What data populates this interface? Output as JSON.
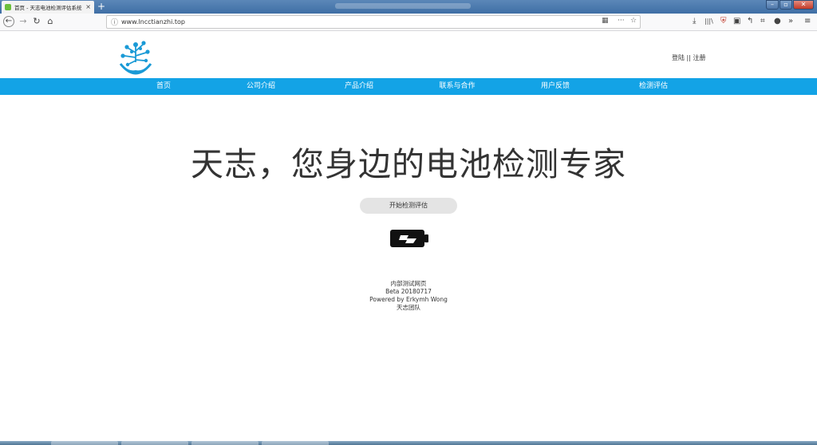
{
  "browser": {
    "tab_title": "首页 - 天志电池检测评估系统",
    "tab_close": "×",
    "new_tab": "+",
    "url": "www.lncctianzhi.top",
    "info_glyph": "ⓘ",
    "reader_glyph": "▦",
    "more_glyph": "···",
    "bookmark_glyph": "☆",
    "back_glyph": "←",
    "forward_glyph": "→",
    "reload_glyph": "↻",
    "home_glyph": "⌂",
    "toolbar_glyphs": [
      "⤓",
      "|||\\",
      "⛨",
      "▣",
      "↰",
      "⌗",
      "●",
      "»",
      "≡"
    ],
    "window_buttons": [
      "–",
      "▫",
      "✕"
    ]
  },
  "header": {
    "login": "登陆",
    "separator": "||",
    "register": "注册"
  },
  "menu": {
    "items": [
      "首页",
      "公司介绍",
      "产品介绍",
      "联系与合作",
      "用户反馈",
      "检测评估"
    ]
  },
  "main": {
    "headline": "天志，您身边的电池检测专家",
    "start_button": "开始检测评估"
  },
  "footer": {
    "line1": "内部测试网页",
    "line2": "Beta 20180717",
    "line3": "Powered by Erkymh Wong",
    "line4": "天志团队"
  },
  "colors": {
    "menu_bar": "#13a3e6",
    "logo_blue": "#1a9ad6",
    "button_bg": "#e4e4e4"
  }
}
